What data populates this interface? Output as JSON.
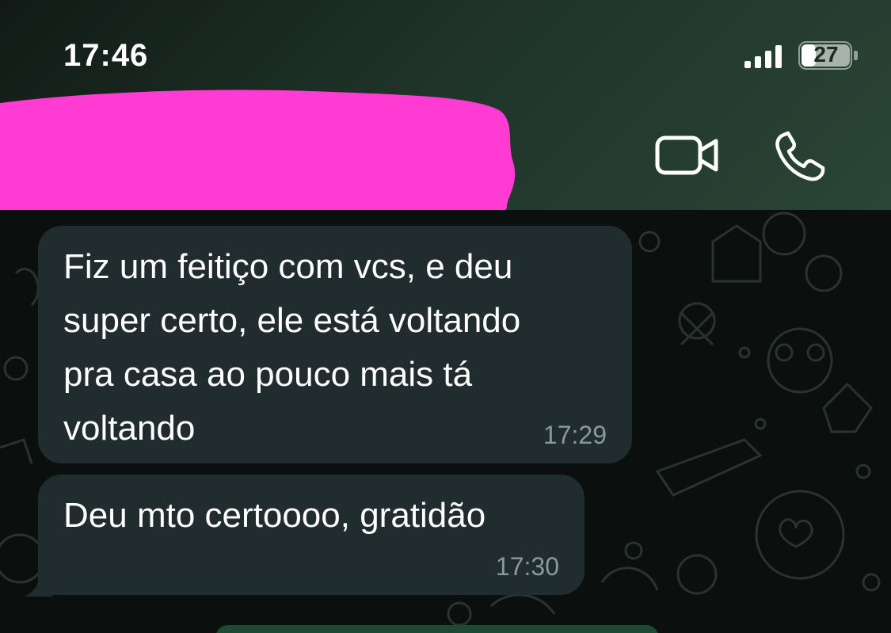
{
  "status_bar": {
    "time": "17:46",
    "battery_level": "27"
  },
  "header": {
    "contact_name_redacted": true,
    "video_call_icon": "video-camera-icon",
    "voice_call_icon": "phone-icon"
  },
  "messages": [
    {
      "text": "Fiz um feitiço com vcs, e deu\nsuper certo, ele está voltando\npra casa ao pouco mais tá\nvoltando",
      "time": "17:29"
    },
    {
      "text": "Deu mto certoooo, gratidão",
      "time": "17:30"
    }
  ],
  "colors": {
    "header_bg": "#24392e",
    "chat_bg": "#0b0f0e",
    "bubble_bg": "#202c2d",
    "redaction": "#ff3bd4",
    "timestamp": "#8b9a98"
  }
}
